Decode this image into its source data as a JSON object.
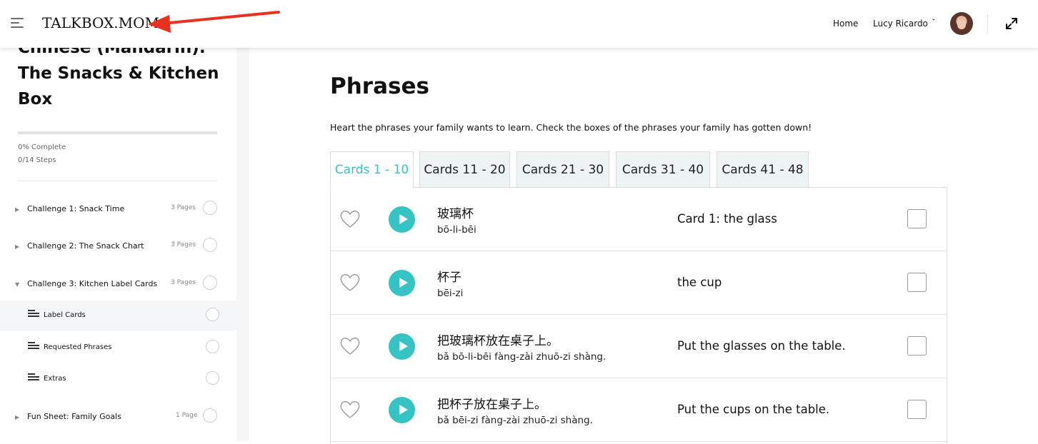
{
  "header": {
    "logo": "TALKBOX.MOM",
    "nav_home": "Home",
    "user_name": "Lucy Ricardo",
    "accent_color": "#36c3c3",
    "annotation_color": "#e8321f"
  },
  "sidebar": {
    "course_title": "Chinese (Mandarin): The Snacks & Kitchen Box",
    "progress_percent": 0,
    "percent_complete": "0% Complete",
    "steps": "0/14 Steps",
    "lessons": [
      {
        "label": "Challenge 1: Snack Time",
        "pages": "3 Pages"
      },
      {
        "label": "Challenge 2: The Snack Chart",
        "pages": "3 Pages"
      },
      {
        "label": "Challenge 3: Kitchen Label Cards",
        "pages": "3 Pages"
      },
      {
        "label": "Fun Sheet: Family Goals",
        "pages": "1 Page"
      }
    ],
    "topics": [
      {
        "label": "Label Cards"
      },
      {
        "label": "Requested Phrases"
      },
      {
        "label": "Extras"
      }
    ]
  },
  "main": {
    "title": "Phrases",
    "intro": "Heart the phrases your family wants to learn. Check the boxes of the phrases your family has gotten down!",
    "tabs": [
      {
        "label": "Cards 1 - 10"
      },
      {
        "label": "Cards 11 - 20"
      },
      {
        "label": "Cards 21 - 30"
      },
      {
        "label": "Cards 31 - 40"
      },
      {
        "label": "Cards 41 - 48"
      }
    ],
    "active_tab": "Cards 1 - 10",
    "cards": [
      {
        "chinese": "玻璃杯",
        "pinyin": "bō-li-bēi",
        "english": "Card 1: the glass"
      },
      {
        "chinese": "杯子",
        "pinyin": "bēi-zi",
        "english": "the cup"
      },
      {
        "chinese": "把玻璃杯放在桌子上。",
        "pinyin": "bǎ bō-li-bēi fàng-zài zhuō-zi shàng.",
        "english": "Put the glasses on the table."
      },
      {
        "chinese": "把杯子放在桌子上。",
        "pinyin": "bǎ bēi-zi fàng-zài zhuō-zi shàng.",
        "english": "Put the cups on the table."
      }
    ]
  }
}
